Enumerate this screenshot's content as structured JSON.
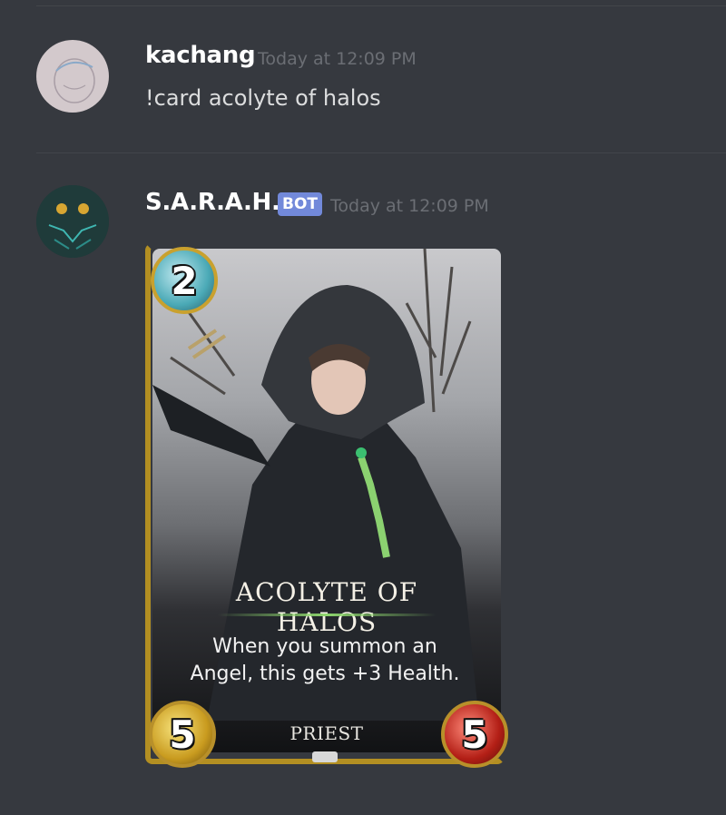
{
  "messages": [
    {
      "username": "kachang",
      "timestamp": "Today at 12:09 PM",
      "text": "!card acolyte of halos"
    },
    {
      "username": "S.A.R.A.H.",
      "badge": "BOT",
      "timestamp": "Today at 12:09 PM",
      "card": {
        "name": "Acolyte of Halos",
        "name_display": "ACOLYTE OF HALOS",
        "cost": "2",
        "attack": "5",
        "health": "5",
        "text": "When you summon an Angel, this gets +3 Health.",
        "tribe_display": "PRIEST"
      }
    }
  ],
  "colors": {
    "background": "#36393f",
    "username": "#ffffff",
    "timestamp": "#6b6e74",
    "message_text": "#dcddde",
    "bot_badge": "#7289da"
  }
}
